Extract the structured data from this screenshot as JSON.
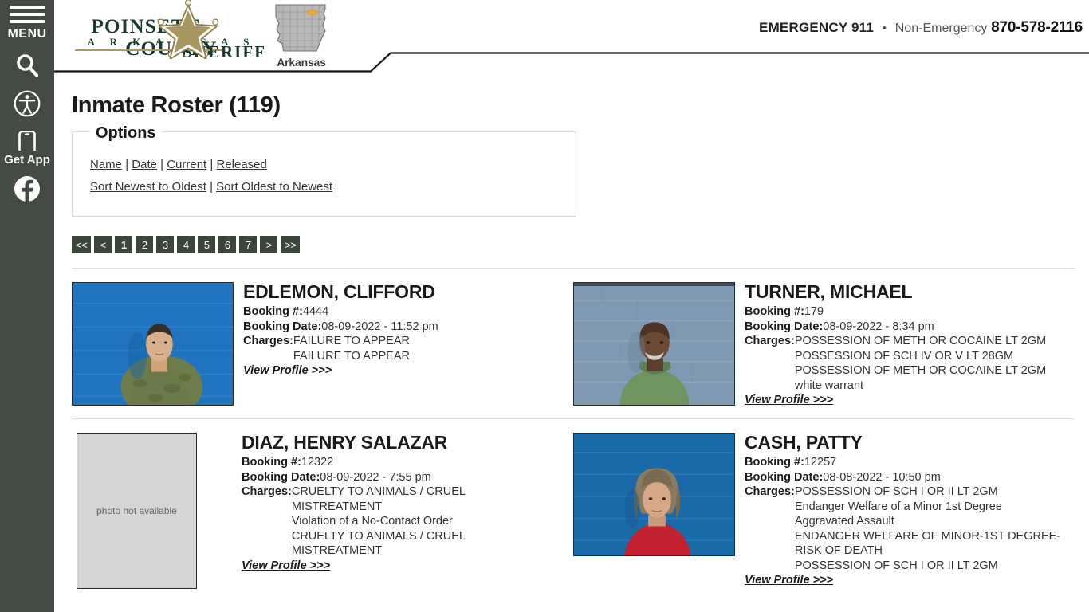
{
  "sidebar": {
    "menu_label": "MENU",
    "items": [
      {
        "name": "hamburger-menu",
        "label": "MENU"
      },
      {
        "name": "search-icon",
        "label": ""
      },
      {
        "name": "accessibility-icon",
        "label": ""
      },
      {
        "name": "get-app-icon",
        "label": "Get App"
      },
      {
        "name": "facebook-icon",
        "label": ""
      }
    ],
    "get_app_label": "Get App",
    "background": "#444b44"
  },
  "header": {
    "logo": {
      "line1": "POINSETT          COUNTY",
      "word_left": "POINSETT",
      "word_right": "COUNTY",
      "subtitle": "A R K A N S A S",
      "sheriff": "SHERIFF",
      "star_color": "#a89660"
    },
    "state_map": {
      "label": "Arkansas",
      "fill": "#b5b5b5",
      "highlight": "#f5a623"
    },
    "contact": {
      "emergency": "EMERGENCY 911",
      "separator": "•",
      "non_emergency_label": "Non-Emergency",
      "phone": "870-578-2116"
    }
  },
  "main": {
    "title": "Inmate Roster (119)",
    "options": {
      "legend": "Options",
      "filters": [
        "Name",
        "Date",
        "Current",
        "Released"
      ],
      "sorts": [
        "Sort Newest to Oldest",
        "Sort Oldest to Newest"
      ],
      "separator": "|"
    },
    "pagination": {
      "first": "<<",
      "prev": "<",
      "pages": [
        "1",
        "2",
        "3",
        "4",
        "5",
        "6",
        "7"
      ],
      "active_page": "1",
      "next": ">",
      "last": ">>"
    },
    "labels": {
      "booking_number": "Booking #:",
      "booking_date": "Booking Date:",
      "charges": "Charges:",
      "view_profile": "View Profile >>>",
      "photo_not_available": "photo not available"
    },
    "inmates": [
      {
        "name": "EDLEMON, CLIFFORD",
        "booking_number": "4444",
        "booking_date": "08-09-2022 - 11:52 pm",
        "charges": [
          "FAILURE TO APPEAR",
          "FAILURE TO APPEAR"
        ],
        "photo": "available",
        "photo_bg": "#1f74bd",
        "shirt": "#6b7a4a",
        "skin": "#d9b08c"
      },
      {
        "name": "TURNER, MICHAEL",
        "booking_number": "179",
        "booking_date": "08-09-2022 - 8:34 pm",
        "charges": [
          "POSSESSION OF METH OR COCAINE LT 2GM",
          "POSSESSION OF SCH IV OR V LT 28GM",
          "POSSESSION OF METH OR COCAINE LT 2GM",
          "white warrant"
        ],
        "photo": "available",
        "photo_bg": "#7f9ab5",
        "shirt": "#6f9460",
        "skin": "#6b4a35"
      },
      {
        "name": "DIAZ, HENRY SALAZAR",
        "booking_number": "12322",
        "booking_date": "08-09-2022 - 7:55 pm",
        "charges": [
          "CRUELTY TO ANIMALS / CRUEL MISTREATMENT",
          "Violation of a No-Contact Order",
          "CRUELTY TO ANIMALS / CRUEL MISTREATMENT"
        ],
        "photo": "not available",
        "photo_bg": "#d6d6d6",
        "shirt": "",
        "skin": ""
      },
      {
        "name": "CASH, PATTY",
        "booking_number": "12257",
        "booking_date": "08-08-2022 - 10:50 pm",
        "charges": [
          "POSSESSION OF SCH I OR II LT 2GM",
          "Endanger Welfare of a Minor 1st Degree",
          "Aggravated Assault",
          "ENDANGER WELFARE OF MINOR-1ST DEGREE-RISK OF DEATH",
          "POSSESSION OF SCH I OR II LT 2GM"
        ],
        "photo": "available",
        "photo_bg": "#1b6aa8",
        "shirt": "#c22230",
        "skin": "#d6a888"
      }
    ]
  }
}
